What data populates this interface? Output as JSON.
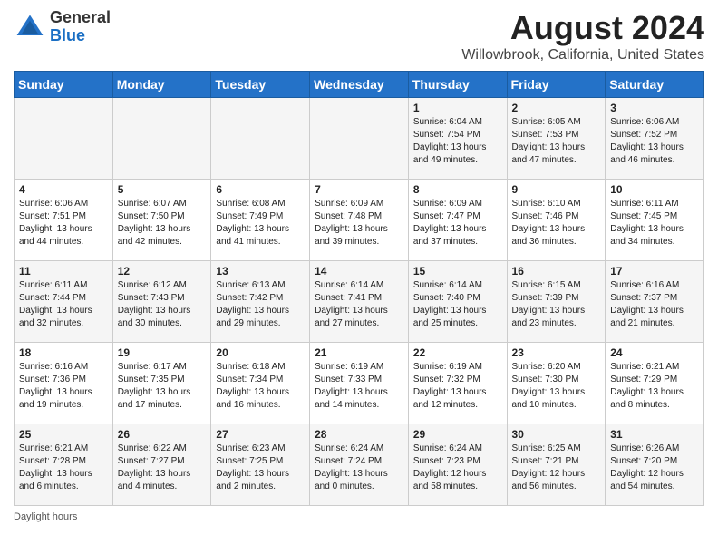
{
  "logo": {
    "general": "General",
    "blue": "Blue"
  },
  "title": "August 2024",
  "subtitle": "Willowbrook, California, United States",
  "days_of_week": [
    "Sunday",
    "Monday",
    "Tuesday",
    "Wednesday",
    "Thursday",
    "Friday",
    "Saturday"
  ],
  "footer": "Daylight hours",
  "weeks": [
    [
      {
        "day": "",
        "info": ""
      },
      {
        "day": "",
        "info": ""
      },
      {
        "day": "",
        "info": ""
      },
      {
        "day": "",
        "info": ""
      },
      {
        "day": "1",
        "info": "Sunrise: 6:04 AM\nSunset: 7:54 PM\nDaylight: 13 hours and 49 minutes."
      },
      {
        "day": "2",
        "info": "Sunrise: 6:05 AM\nSunset: 7:53 PM\nDaylight: 13 hours and 47 minutes."
      },
      {
        "day": "3",
        "info": "Sunrise: 6:06 AM\nSunset: 7:52 PM\nDaylight: 13 hours and 46 minutes."
      }
    ],
    [
      {
        "day": "4",
        "info": "Sunrise: 6:06 AM\nSunset: 7:51 PM\nDaylight: 13 hours and 44 minutes."
      },
      {
        "day": "5",
        "info": "Sunrise: 6:07 AM\nSunset: 7:50 PM\nDaylight: 13 hours and 42 minutes."
      },
      {
        "day": "6",
        "info": "Sunrise: 6:08 AM\nSunset: 7:49 PM\nDaylight: 13 hours and 41 minutes."
      },
      {
        "day": "7",
        "info": "Sunrise: 6:09 AM\nSunset: 7:48 PM\nDaylight: 13 hours and 39 minutes."
      },
      {
        "day": "8",
        "info": "Sunrise: 6:09 AM\nSunset: 7:47 PM\nDaylight: 13 hours and 37 minutes."
      },
      {
        "day": "9",
        "info": "Sunrise: 6:10 AM\nSunset: 7:46 PM\nDaylight: 13 hours and 36 minutes."
      },
      {
        "day": "10",
        "info": "Sunrise: 6:11 AM\nSunset: 7:45 PM\nDaylight: 13 hours and 34 minutes."
      }
    ],
    [
      {
        "day": "11",
        "info": "Sunrise: 6:11 AM\nSunset: 7:44 PM\nDaylight: 13 hours and 32 minutes."
      },
      {
        "day": "12",
        "info": "Sunrise: 6:12 AM\nSunset: 7:43 PM\nDaylight: 13 hours and 30 minutes."
      },
      {
        "day": "13",
        "info": "Sunrise: 6:13 AM\nSunset: 7:42 PM\nDaylight: 13 hours and 29 minutes."
      },
      {
        "day": "14",
        "info": "Sunrise: 6:14 AM\nSunset: 7:41 PM\nDaylight: 13 hours and 27 minutes."
      },
      {
        "day": "15",
        "info": "Sunrise: 6:14 AM\nSunset: 7:40 PM\nDaylight: 13 hours and 25 minutes."
      },
      {
        "day": "16",
        "info": "Sunrise: 6:15 AM\nSunset: 7:39 PM\nDaylight: 13 hours and 23 minutes."
      },
      {
        "day": "17",
        "info": "Sunrise: 6:16 AM\nSunset: 7:37 PM\nDaylight: 13 hours and 21 minutes."
      }
    ],
    [
      {
        "day": "18",
        "info": "Sunrise: 6:16 AM\nSunset: 7:36 PM\nDaylight: 13 hours and 19 minutes."
      },
      {
        "day": "19",
        "info": "Sunrise: 6:17 AM\nSunset: 7:35 PM\nDaylight: 13 hours and 17 minutes."
      },
      {
        "day": "20",
        "info": "Sunrise: 6:18 AM\nSunset: 7:34 PM\nDaylight: 13 hours and 16 minutes."
      },
      {
        "day": "21",
        "info": "Sunrise: 6:19 AM\nSunset: 7:33 PM\nDaylight: 13 hours and 14 minutes."
      },
      {
        "day": "22",
        "info": "Sunrise: 6:19 AM\nSunset: 7:32 PM\nDaylight: 13 hours and 12 minutes."
      },
      {
        "day": "23",
        "info": "Sunrise: 6:20 AM\nSunset: 7:30 PM\nDaylight: 13 hours and 10 minutes."
      },
      {
        "day": "24",
        "info": "Sunrise: 6:21 AM\nSunset: 7:29 PM\nDaylight: 13 hours and 8 minutes."
      }
    ],
    [
      {
        "day": "25",
        "info": "Sunrise: 6:21 AM\nSunset: 7:28 PM\nDaylight: 13 hours and 6 minutes."
      },
      {
        "day": "26",
        "info": "Sunrise: 6:22 AM\nSunset: 7:27 PM\nDaylight: 13 hours and 4 minutes."
      },
      {
        "day": "27",
        "info": "Sunrise: 6:23 AM\nSunset: 7:25 PM\nDaylight: 13 hours and 2 minutes."
      },
      {
        "day": "28",
        "info": "Sunrise: 6:24 AM\nSunset: 7:24 PM\nDaylight: 13 hours and 0 minutes."
      },
      {
        "day": "29",
        "info": "Sunrise: 6:24 AM\nSunset: 7:23 PM\nDaylight: 12 hours and 58 minutes."
      },
      {
        "day": "30",
        "info": "Sunrise: 6:25 AM\nSunset: 7:21 PM\nDaylight: 12 hours and 56 minutes."
      },
      {
        "day": "31",
        "info": "Sunrise: 6:26 AM\nSunset: 7:20 PM\nDaylight: 12 hours and 54 minutes."
      }
    ]
  ]
}
